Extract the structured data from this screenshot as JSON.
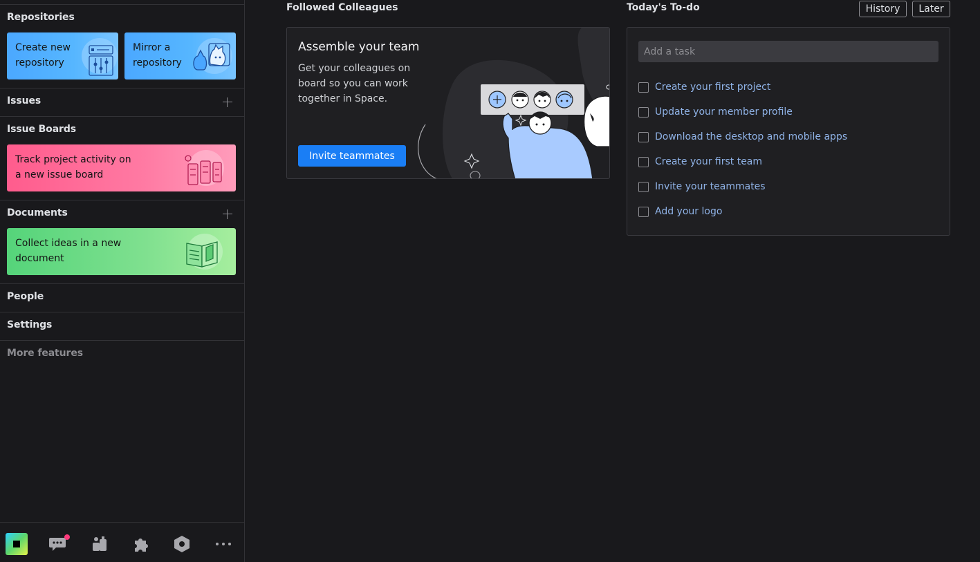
{
  "sidebar": {
    "repositories": {
      "title": "Repositories",
      "cards": [
        {
          "label": "Create new repository"
        },
        {
          "label": "Mirror a repository"
        }
      ]
    },
    "issues": {
      "title": "Issues"
    },
    "issue_boards": {
      "title": "Issue Boards",
      "card": {
        "label": "Track project activity on a new issue board"
      }
    },
    "documents": {
      "title": "Documents",
      "card": {
        "label": "Collect ideas in a new document"
      }
    },
    "people": {
      "title": "People"
    },
    "settings": {
      "title": "Settings"
    },
    "more": {
      "title": "More features"
    },
    "toolbar": {
      "icons": [
        "space-logo-icon",
        "chat-icon",
        "teams-icon",
        "extensions-icon",
        "admin-icon",
        "more-icon"
      ],
      "chat_badge_color": "#ff3a7c"
    }
  },
  "colleagues": {
    "header": "Followed Colleagues",
    "title": "Assemble your team",
    "description": "Get your colleagues on board so you can work together in Space.",
    "invite_label": "Invite teammates"
  },
  "todo": {
    "header": "Today's To-do",
    "history_label": "History",
    "later_label": "Later",
    "input_placeholder": "Add a task",
    "items": [
      {
        "label": "Create your first project",
        "checked": false
      },
      {
        "label": "Update your member profile",
        "checked": false
      },
      {
        "label": "Download the desktop and mobile apps",
        "checked": false
      },
      {
        "label": "Create your first team",
        "checked": false
      },
      {
        "label": "Invite your teammates",
        "checked": false
      },
      {
        "label": "Add your logo",
        "checked": false
      }
    ]
  },
  "colors": {
    "background": "#19191c",
    "accent": "#1a7ef5",
    "todo_link": "#8fb2e6"
  }
}
